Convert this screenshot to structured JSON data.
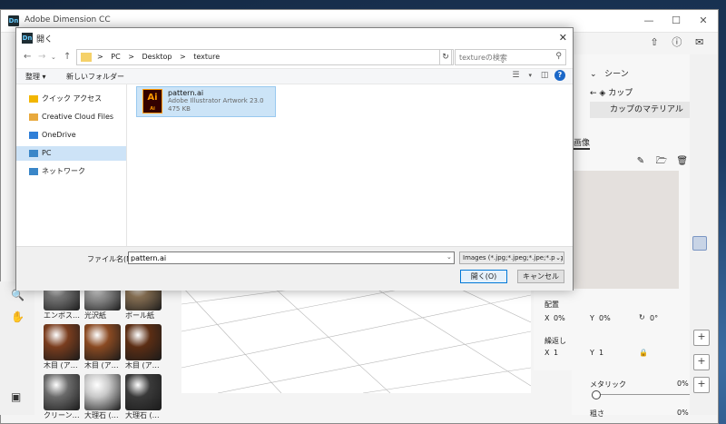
{
  "app": {
    "title": "Adobe Dimension CC",
    "icon_text": "Dn",
    "window_controls": [
      "minimize-icon",
      "maximize-icon",
      "close-icon"
    ]
  },
  "header_icons": [
    "share-icon",
    "help-icon",
    "comment-icon"
  ],
  "right_panel": {
    "scene_label": "シーン",
    "cup_label": "カップ",
    "material_label": "カップのマテリアル",
    "image_tab": "画像"
  },
  "properties": {
    "placement_label": "配置",
    "x_label": "X",
    "x_value": "0%",
    "y_label": "Y",
    "y_value": "0%",
    "rotation_value": "0°",
    "repeat_label": "繰返し",
    "repeat_x_label": "X",
    "repeat_x_value": "1",
    "repeat_y_label": "Y",
    "repeat_y_value": "1",
    "metallic_label": "メタリック",
    "metallic_value": "0%",
    "metallic_level": 0,
    "roughness_label": "粗さ",
    "roughness_value": "0%"
  },
  "materials": [
    {
      "name": "エンボス…",
      "color": "#7a7a7a"
    },
    {
      "name": "光沢紙",
      "color": "#9a9a9a"
    },
    {
      "name": "ボール紙",
      "color": "#8a7255"
    },
    {
      "name": "木目 (ア…",
      "color": "#7a3d1e"
    },
    {
      "name": "木目 (ア…",
      "color": "#8a4a22"
    },
    {
      "name": "木目 (ア…",
      "color": "#5c2e14"
    },
    {
      "name": "クリーン…",
      "color": "#6b6b6b"
    },
    {
      "name": "大理石 (…",
      "color": "#c8c8c8"
    },
    {
      "name": "大理石 (…",
      "color": "#3a3a3a"
    }
  ],
  "dialog": {
    "title": "開く",
    "path": [
      "PC",
      "Desktop",
      "texture"
    ],
    "search_placeholder": "textureの検索",
    "organize_label": "整理 ▾",
    "new_folder_label": "新しいフォルダー",
    "nav_items": [
      {
        "label": "クイック アクセス",
        "icon": "star-icon",
        "color": "#f2b600"
      },
      {
        "label": "Creative Cloud Files",
        "icon": "cc-folder-icon",
        "color": "#e8a93d"
      },
      {
        "label": "OneDrive",
        "icon": "cloud-icon",
        "color": "#2f7fd8"
      },
      {
        "label": "PC",
        "icon": "computer-icon",
        "color": "#3a86c8",
        "selected": true
      },
      {
        "label": "ネットワーク",
        "icon": "network-icon",
        "color": "#3a86c8"
      }
    ],
    "file": {
      "name": "pattern.ai",
      "type": "Adobe Illustrator Artwork 23.0",
      "size": "475 KB",
      "icon_text": "Ai"
    },
    "filename_label": "ファイル名(N):",
    "filename_value": "pattern.ai",
    "filetype_value": "Images (*.jpg;*.jpeg;*.jpe;*.png;",
    "open_label": "開く(O)",
    "cancel_label": "キャンセル"
  }
}
